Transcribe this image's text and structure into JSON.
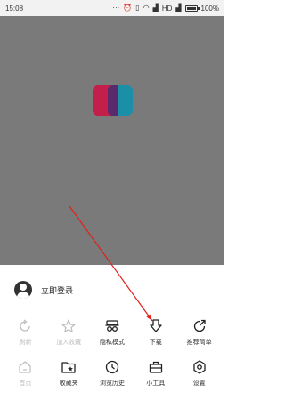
{
  "status_bar": {
    "time": "15:08",
    "network": "HD",
    "battery": "100%",
    "battery_level": 1.0
  },
  "overlay": {
    "logo_colors": {
      "left": "#c41e4a",
      "right": "#1b8fa8",
      "overlap": "#5a2a6a"
    }
  },
  "menu": {
    "login_label": "立即登录",
    "row1": [
      {
        "label": "刷新",
        "icon": "refresh-icon",
        "disabled": true
      },
      {
        "label": "加入收藏",
        "icon": "star-icon",
        "disabled": true
      },
      {
        "label": "隐私模式",
        "icon": "incognito-icon",
        "disabled": false
      },
      {
        "label": "下载",
        "icon": "download-icon",
        "disabled": false
      },
      {
        "label": "推荐简单",
        "icon": "share-icon",
        "disabled": false
      }
    ],
    "row2": [
      {
        "label": "首页",
        "icon": "home-icon",
        "disabled": true
      },
      {
        "label": "收藏夹",
        "icon": "bookmark-folder-icon",
        "disabled": false
      },
      {
        "label": "浏览历史",
        "icon": "clock-icon",
        "disabled": false
      },
      {
        "label": "小工具",
        "icon": "toolbox-icon",
        "disabled": false
      },
      {
        "label": "设置",
        "icon": "settings-icon",
        "disabled": false
      }
    ]
  },
  "annotation": {
    "color": "#e0201b"
  }
}
